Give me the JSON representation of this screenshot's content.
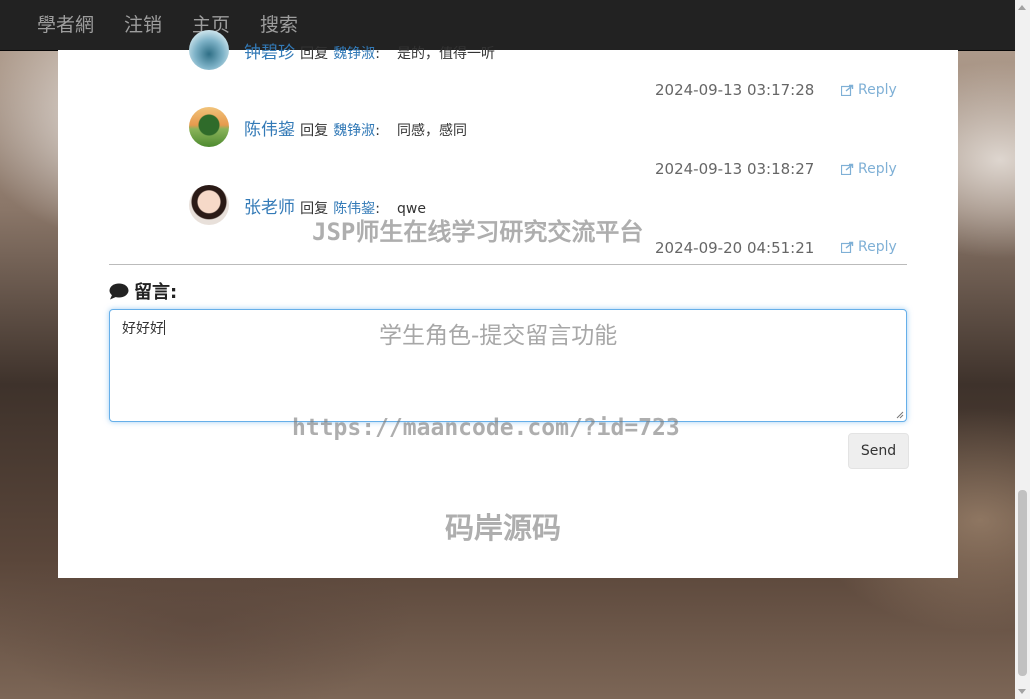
{
  "nav": {
    "brand": "學者網",
    "items": [
      "注销",
      "主页",
      "搜索"
    ]
  },
  "comments": [
    {
      "user": "钟碧珍",
      "reply_word": "回复",
      "target": "魏铮淑",
      "colon": ":",
      "body": "是的，值得一听",
      "time": "2024-09-13 03:17:28",
      "reply_label": "Reply"
    },
    {
      "user": "陈伟鋆",
      "reply_word": "回复",
      "target": "魏铮淑",
      "colon": ":",
      "body": "同感，感同",
      "time": "2024-09-13 03:18:27",
      "reply_label": "Reply"
    },
    {
      "user": "张老师",
      "reply_word": "回复",
      "target": "陈伟鋆",
      "colon": ":",
      "body": "qwe",
      "time": "2024-09-20 04:51:21",
      "reply_label": "Reply"
    }
  ],
  "message": {
    "title": "留言:",
    "value": "好好好",
    "send_label": "Send"
  },
  "watermarks": {
    "platform": "JSP师生在线学习研究交流平台",
    "feature": "学生角色-提交留言功能",
    "url": "https://maancode.com/?id=723",
    "brand": "码岸源码"
  },
  "colors": {
    "link": "#337ab7",
    "navbar": "#222222",
    "focus": "#66afe9"
  }
}
